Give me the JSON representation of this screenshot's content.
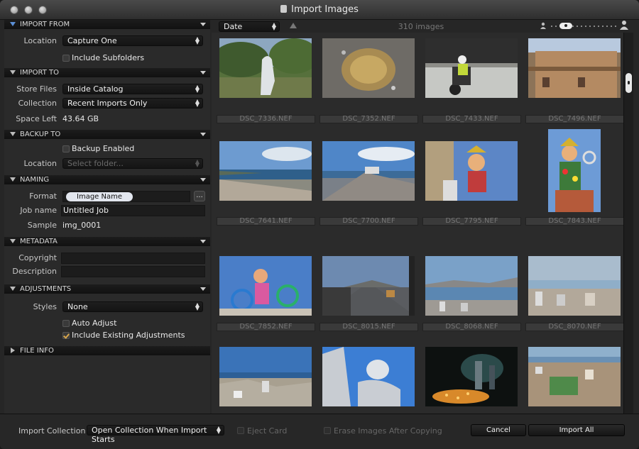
{
  "window": {
    "title": "Import Images"
  },
  "sidebar": {
    "import_from": {
      "header": "IMPORT FROM",
      "location_label": "Location",
      "location_value": "Capture One",
      "include_subfolders": "Include Subfolders"
    },
    "import_to": {
      "header": "IMPORT TO",
      "store_files_label": "Store Files",
      "store_files_value": "Inside Catalog",
      "collection_label": "Collection",
      "collection_value": "Recent Imports Only",
      "space_left_label": "Space Left",
      "space_left_value": "43.64 GB"
    },
    "backup_to": {
      "header": "BACKUP TO",
      "backup_enabled": "Backup Enabled",
      "location_label": "Location",
      "location_placeholder": "Select folder..."
    },
    "naming": {
      "header": "NAMING",
      "format_label": "Format",
      "format_token": "Image Name",
      "format_button": "...",
      "job_name_label": "Job name",
      "job_name_value": "Untitled Job",
      "sample_label": "Sample",
      "sample_value": "img_0001"
    },
    "metadata": {
      "header": "METADATA",
      "copyright_label": "Copyright",
      "description_label": "Description"
    },
    "adjustments": {
      "header": "ADJUSTMENTS",
      "styles_label": "Styles",
      "styles_value": "None",
      "auto_adjust": "Auto Adjust",
      "include_existing": "Include Existing Adjustments"
    },
    "file_info": {
      "header": "FILE INFO"
    }
  },
  "toolbar": {
    "sort_value": "Date",
    "image_count": "310 images"
  },
  "images": [
    {
      "name": "DSC_7336.NEF",
      "scene": "statue"
    },
    {
      "name": "DSC_7352.NEF",
      "scene": "cactus"
    },
    {
      "name": "DSC_7433.NEF",
      "scene": "scooter"
    },
    {
      "name": "DSC_7496.NEF",
      "scene": "building"
    },
    {
      "name": "DSC_7641.NEF",
      "scene": "beach"
    },
    {
      "name": "DSC_7700.NEF",
      "scene": "promenade"
    },
    {
      "name": "DSC_7795.NEF",
      "scene": "carnival"
    },
    {
      "name": "DSC_7843.NEF",
      "scene": "carnival-tall"
    },
    {
      "name": "DSC_7852.NEF",
      "scene": "carnival-figure"
    },
    {
      "name": "DSC_8015.NEF",
      "scene": "road"
    },
    {
      "name": "DSC_8068.NEF",
      "scene": "bay"
    },
    {
      "name": "DSC_8070.NEF",
      "scene": "city"
    },
    {
      "name": "",
      "scene": "coast-city"
    },
    {
      "name": "",
      "scene": "angel"
    },
    {
      "name": "",
      "scene": "candles"
    },
    {
      "name": "",
      "scene": "city-view"
    }
  ],
  "footer": {
    "import_collection_label": "Import Collection",
    "import_collection_value": "Open Collection When Import Starts",
    "eject_card": "Eject Card",
    "erase_images": "Erase Images After Copying",
    "cancel": "Cancel",
    "import_all": "Import All"
  }
}
